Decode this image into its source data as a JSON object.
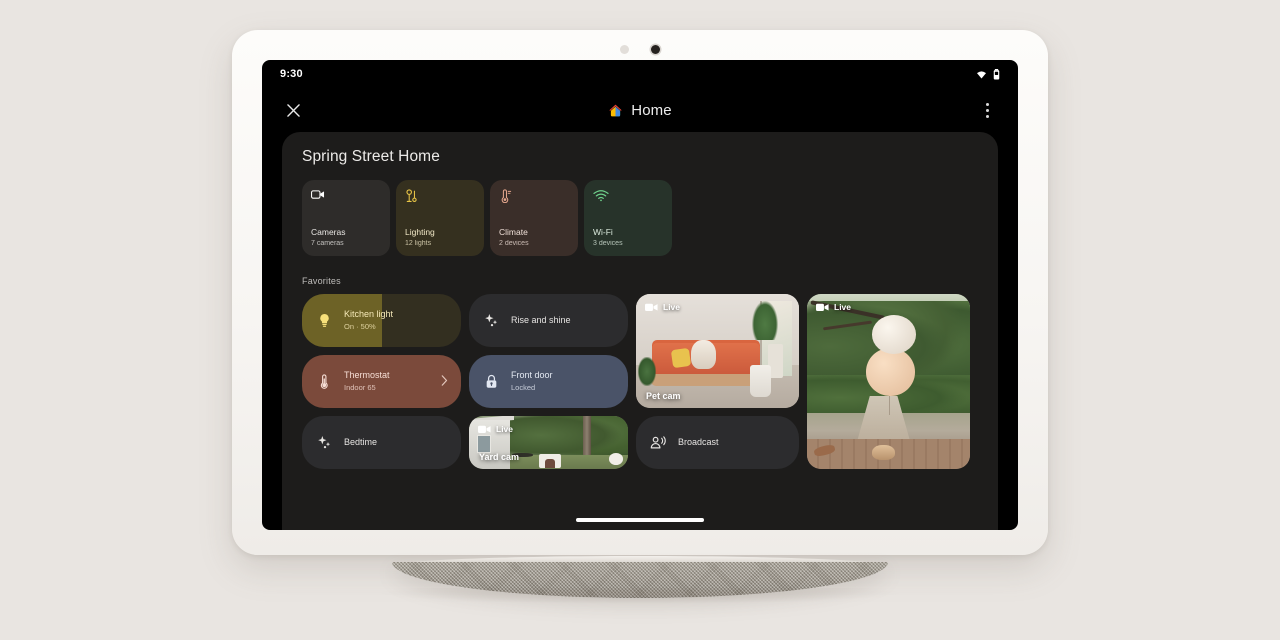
{
  "device": {
    "type": "smart-display",
    "sensors": [
      "ambient-light-sensor",
      "camera"
    ]
  },
  "status_bar": {
    "time": "9:30",
    "icons": [
      "wifi-icon",
      "battery-icon"
    ]
  },
  "app_bar": {
    "close_label": "✕",
    "title": "Home",
    "logo": "google-home-logo",
    "overflow_label": "More options"
  },
  "sheet": {
    "home_name": "Spring Street Home",
    "favorites_label": "Favorites"
  },
  "categories": [
    {
      "name": "cameras",
      "icon": "video-camera-icon",
      "label": "Cameras",
      "sub": "7 cameras",
      "bg": "#2e2c2a",
      "fg": "#e8e6e3",
      "accent": "#ffffff"
    },
    {
      "name": "lighting",
      "icon": "lamp-icon",
      "label": "Lighting",
      "sub": "12 lights",
      "bg": "#35301f",
      "fg": "#f0e7c6",
      "accent": "#e8c547"
    },
    {
      "name": "climate",
      "icon": "thermostat-icon",
      "label": "Climate",
      "sub": "2 devices",
      "bg": "#3a2e29",
      "fg": "#efdfd7",
      "accent": "#e3a58c"
    },
    {
      "name": "wifi",
      "icon": "wifi-icon",
      "label": "Wi-Fi",
      "sub": "3 devices",
      "bg": "#27332a",
      "fg": "#dbeadd",
      "accent": "#6ecf8b"
    }
  ],
  "favorites": [
    {
      "name": "kitchen-light",
      "icon": "lightbulb-icon",
      "title": "Kitchen light",
      "sub": "On · 50%",
      "brightness": 50,
      "bg": "#332f20",
      "fill": "#6d6226",
      "fg": "#f5e9b8"
    },
    {
      "name": "rise-and-shine",
      "icon": "sparkle-icon",
      "title": "Rise and shine",
      "sub": "",
      "bg": "#2c2c2e",
      "fg": "#e6e4e2"
    },
    {
      "name": "thermostat",
      "icon": "thermometer-icon",
      "title": "Thermostat",
      "sub": "Indoor 65",
      "bg": "#7b4a3b",
      "fg": "#f6ded5",
      "chevron": "›"
    },
    {
      "name": "front-door",
      "icon": "lock-icon",
      "title": "Front door",
      "sub": "Locked",
      "bg": "#4a5368",
      "fg": "#e3e8f2"
    },
    {
      "name": "bedtime",
      "icon": "sparkle-icon",
      "title": "Bedtime",
      "sub": "",
      "bg": "#2c2c2e",
      "fg": "#e6e4e2"
    },
    {
      "name": "broadcast",
      "icon": "broadcast-icon",
      "title": "Broadcast",
      "sub": "",
      "bg": "#2c2c2e",
      "fg": "#e6e4e2"
    }
  ],
  "cameras": [
    {
      "name": "pet-cam",
      "label": "Pet cam",
      "live_badge": "Live",
      "scene": "living-room-dog-on-orange-sofa"
    },
    {
      "name": "garden-cam",
      "label": "",
      "live_badge": "Live",
      "scene": "backyard-garden-balloons"
    },
    {
      "name": "yard-cam",
      "label": "Yard cam",
      "live_badge": "Live",
      "scene": "side-yard-house-doghouse"
    }
  ],
  "colors": {
    "page_background": "#e9e5e1",
    "screen_background": "#000000",
    "sheet_background": "#1d1c1b",
    "device_shell": "#fdfcfa",
    "speaker_fabric": "#9e978b"
  }
}
